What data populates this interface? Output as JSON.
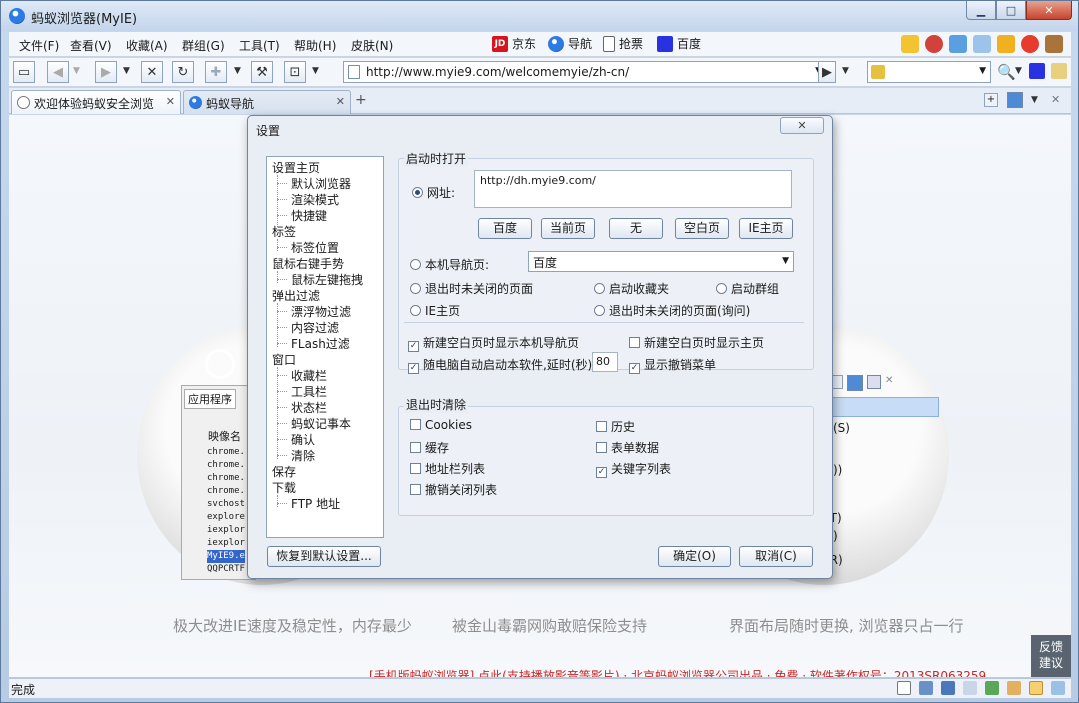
{
  "window": {
    "title": "蚂蚁浏览器(MyIE)",
    "caption": {
      "min": "▁",
      "max": "□",
      "close": "✕"
    }
  },
  "menu": [
    "文件(F)",
    "查看(V)",
    "收藏(A)",
    "群组(G)",
    "工具(T)",
    "帮助(H)",
    "皮肤(N)"
  ],
  "quicklinks": [
    "京东",
    "导航",
    "抢票",
    "百度"
  ],
  "quicklink_icons": {
    "jd": "JD"
  },
  "address": {
    "url": "http://www.myie9.com/welcomemyie/zh-cn/"
  },
  "tabs": [
    {
      "label": "欢迎体验蚂蚁安全浏览",
      "close": "✕"
    },
    {
      "label": "蚂蚁导航",
      "close": "✕"
    }
  ],
  "new_tab": "+",
  "background": {
    "slogans": [
      "极大改进IE速度及稳定性，内存最少",
      "被金山毒霸网购敢赔保险支持",
      "界面布局随时更换, 浏览器只占一行"
    ],
    "footer": "[手机版蚂蚁浏览器] 点此(支持播放影音等影片) · 北京蚂蚁浏览器公司出品 · 免费 · 软件著作权号：2013SR063259",
    "feedback": [
      "反馈",
      "建议"
    ],
    "fake_app_tab": "应用程序",
    "fake_col": "映像名",
    "fake_procs": [
      "chrome.",
      "chrome.",
      "chrome.",
      "chrome.",
      "svchost",
      "explore",
      "iexplor",
      "iexplor",
      "MyIE9.e",
      "QQPCRTF"
    ],
    "fake_menu": [
      "(S)",
      "))",
      "栏(T)",
      ")",
      "栏(R)"
    ]
  },
  "status": {
    "text": "完成"
  },
  "dialog": {
    "title": "设置",
    "close": "✕",
    "tree": [
      {
        "label": "设置主页",
        "level": 0
      },
      {
        "label": "默认浏览器",
        "level": 1
      },
      {
        "label": "渲染模式",
        "level": 1
      },
      {
        "label": "快捷键",
        "level": 1
      },
      {
        "label": "标签",
        "level": 0
      },
      {
        "label": "标签位置",
        "level": 1
      },
      {
        "label": "鼠标右键手势",
        "level": 0
      },
      {
        "label": "鼠标左键拖拽",
        "level": 1
      },
      {
        "label": "弹出过滤",
        "level": 0
      },
      {
        "label": "漂浮物过滤",
        "level": 1
      },
      {
        "label": "内容过滤",
        "level": 1
      },
      {
        "label": "FLash过滤",
        "level": 1
      },
      {
        "label": "窗口",
        "level": 0
      },
      {
        "label": "收藏栏",
        "level": 1
      },
      {
        "label": "工具栏",
        "level": 1
      },
      {
        "label": "状态栏",
        "level": 1
      },
      {
        "label": "蚂蚁记事本",
        "level": 1
      },
      {
        "label": "确认",
        "level": 1
      },
      {
        "label": "清除",
        "level": 1
      },
      {
        "label": "保存",
        "level": 0
      },
      {
        "label": "下载",
        "level": 0
      },
      {
        "label": "FTP 地址",
        "level": 1
      }
    ],
    "startup": {
      "group_label": "启动时打开",
      "url_label": "网址:",
      "url_value": "http://dh.myie9.com/",
      "url_buttons": [
        "百度",
        "当前页",
        "无",
        "空白页",
        "IE主页"
      ],
      "local_nav_label": "本机导航页:",
      "local_nav_value": "百度",
      "radio_options": [
        "退出时未关闭的页面",
        "启动收藏夹",
        "启动群组",
        "IE主页",
        "退出时未关闭的页面(询问)"
      ],
      "check_options": [
        "新建空白页时显示本机导航页",
        "新建空白页时显示主页",
        "随电脑自动启动本软件,延时(秒)",
        "显示撤销菜单"
      ],
      "delay_value": "80"
    },
    "clear": {
      "group_label": "退出时清除",
      "options": [
        "Cookies",
        "历史",
        "缓存",
        "表单数据",
        "地址栏列表",
        "关键字列表",
        "撤销关闭列表"
      ]
    },
    "buttons": {
      "reset": "恢复到默认设置...",
      "ok": "确定(O)",
      "cancel": "取消(C)"
    },
    "check_mark": "✓"
  }
}
